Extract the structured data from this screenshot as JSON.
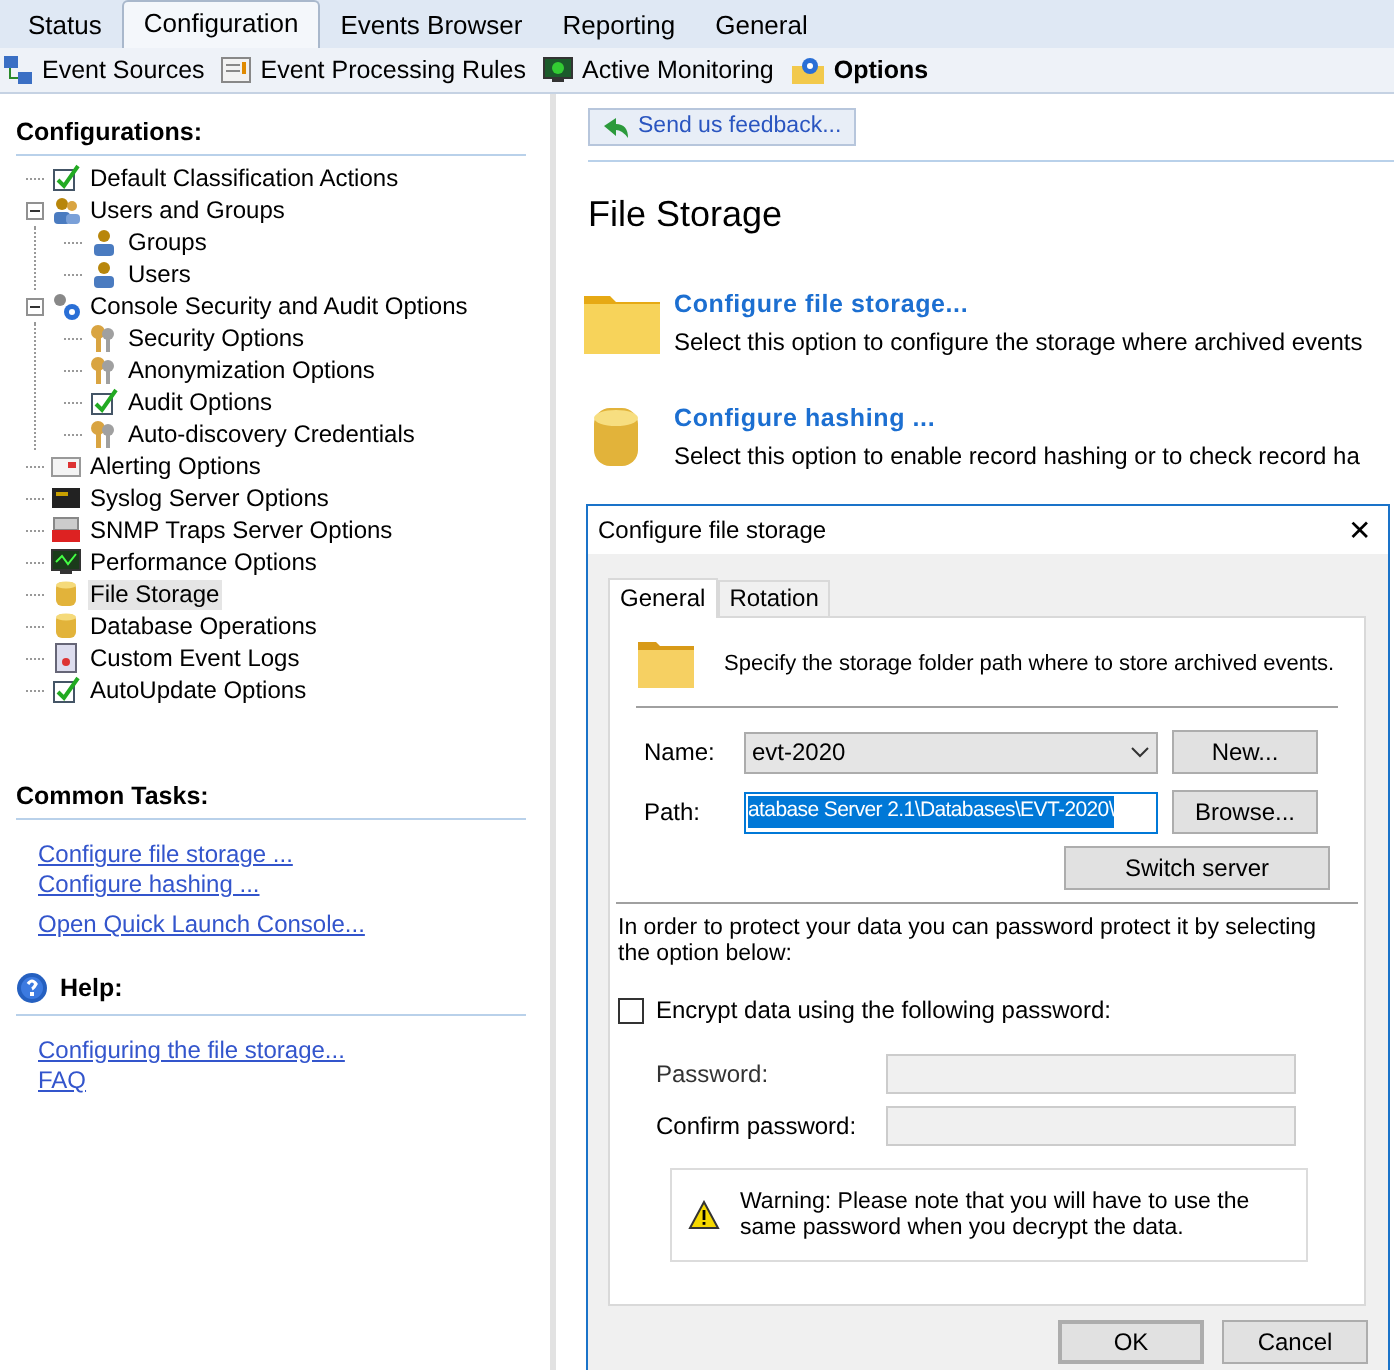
{
  "top_tabs": [
    {
      "label": "Status",
      "selected": false
    },
    {
      "label": "Configuration",
      "selected": true
    },
    {
      "label": "Events Browser",
      "selected": false
    },
    {
      "label": "Reporting",
      "selected": false
    },
    {
      "label": "General",
      "selected": false
    }
  ],
  "toolbar": [
    {
      "label": "Event Sources",
      "selected": false
    },
    {
      "label": "Event Processing Rules",
      "selected": false
    },
    {
      "label": "Active Monitoring",
      "selected": false
    },
    {
      "label": "Options",
      "selected": true
    }
  ],
  "sidebar": {
    "heading": "Configurations:",
    "tree": [
      {
        "label": "Default Classification Actions",
        "selected": false
      },
      {
        "label": "Users and Groups",
        "selected": false,
        "expanded": true,
        "children": [
          {
            "label": "Groups",
            "selected": false
          },
          {
            "label": "Users",
            "selected": false
          }
        ]
      },
      {
        "label": "Console Security and Audit Options",
        "selected": false,
        "expanded": true,
        "children": [
          {
            "label": "Security Options",
            "selected": false
          },
          {
            "label": "Anonymization Options",
            "selected": false
          },
          {
            "label": "Audit Options",
            "selected": false
          },
          {
            "label": "Auto-discovery Credentials",
            "selected": false
          }
        ]
      },
      {
        "label": "Alerting Options",
        "selected": false
      },
      {
        "label": "Syslog Server Options",
        "selected": false
      },
      {
        "label": "SNMP Traps Server Options",
        "selected": false
      },
      {
        "label": "Performance Options",
        "selected": false
      },
      {
        "label": "File Storage",
        "selected": true
      },
      {
        "label": "Database Operations",
        "selected": false
      },
      {
        "label": "Custom Event Logs",
        "selected": false
      },
      {
        "label": "AutoUpdate Options",
        "selected": false
      }
    ],
    "common_tasks": {
      "heading": "Common Tasks:",
      "links": [
        [
          "Configure file storage ...",
          "Configure hashing ..."
        ],
        [
          "Open Quick Launch Console..."
        ]
      ]
    },
    "help": {
      "heading": "Help:",
      "links": [
        "Configuring the file storage...",
        "FAQ"
      ]
    }
  },
  "content": {
    "feedback_button": "Send us feedback...",
    "title": "File Storage",
    "options": [
      {
        "title": "Configure file storage...",
        "description": "Select this option to configure the storage where archived events"
      },
      {
        "title": "Configure hashing ...",
        "description": "Select this option to enable record hashing or to check record ha"
      }
    ]
  },
  "dialog": {
    "title": "Configure file storage",
    "close": "✕",
    "tabs": [
      {
        "label": "General",
        "selected": true
      },
      {
        "label": "Rotation",
        "selected": false
      }
    ],
    "intro": "Specify the storage folder path where to store archived events.",
    "name_label": "Name:",
    "name_value": "evt-2020",
    "new_button": "New...",
    "path_label": "Path:",
    "path_value": "atabase Server 2.1\\Databases\\EVT-2020\\",
    "browse_button": "Browse...",
    "switch_button": "Switch server",
    "protect_text": "In order to protect your data you can password protect it by selecting the option below:",
    "encrypt": {
      "label": "Encrypt data using the following password:",
      "checked": false
    },
    "password_label": "Password:",
    "confirm_label": "Confirm password:",
    "password_disabled": true,
    "warning": "Warning: Please note that you will have to use the same password when you decrypt the data.",
    "ok_button": "OK",
    "cancel_button": "Cancel"
  }
}
